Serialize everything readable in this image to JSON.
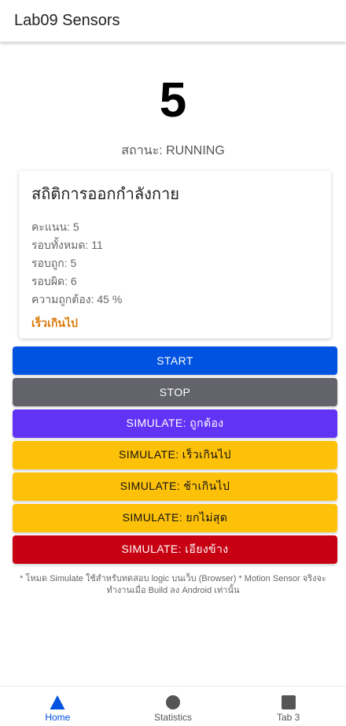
{
  "app": {
    "title": "Lab09 Sensors"
  },
  "score": {
    "value": "5"
  },
  "status": {
    "text": "สถานะ: RUNNING"
  },
  "stats": {
    "title": "สถิติการออกกำลังกาย",
    "score": "คะแนน: 5",
    "total": "รอบทั้งหมด: 11",
    "correct": "รอบถูก: 5",
    "wrong": "รอบผิด: 6",
    "accuracy": "ความถูกต้อง: 45 %",
    "feedback": "เร็วเกินไป",
    "feedback_color": "#d97706"
  },
  "buttons": {
    "start": {
      "label": "START",
      "bg": "#0052e0",
      "fg": "#ffffff"
    },
    "stop": {
      "label": "STOP",
      "bg": "#63646b",
      "fg": "#ffffff"
    },
    "sim_correct": {
      "label": "SIMULATE: ถูกต้อง",
      "bg": "#6133f5",
      "fg": "#ffffff"
    },
    "sim_fast": {
      "label": "SIMULATE: เร็วเกินไป",
      "bg": "#fdc10a",
      "fg": "#111111"
    },
    "sim_slow": {
      "label": "SIMULATE: ช้าเกินไป",
      "bg": "#fdc10a",
      "fg": "#111111"
    },
    "sim_nofull": {
      "label": "SIMULATE: ยกไม่สุด",
      "bg": "#fdc10a",
      "fg": "#111111"
    },
    "sim_tilt": {
      "label": "SIMULATE: เอียงข้าง",
      "bg": "#c70012",
      "fg": "#ffffff"
    }
  },
  "note": {
    "text": "* โหมด Simulate ใช้สำหรับทดสอบ logic บนเว็บ (Browser) * Motion Sensor จริงจะทำงานเมื่อ Build ลง Android เท่านั้น"
  },
  "tabs": [
    {
      "label": "Home",
      "icon": "triangle-icon",
      "active": true
    },
    {
      "label": "Statistics",
      "icon": "circle-icon",
      "active": false
    },
    {
      "label": "Tab 3",
      "icon": "square-icon",
      "active": false
    }
  ],
  "colors": {
    "tab_active": "#0052e0",
    "tab_inactive": "#555555",
    "tab_icon_inactive": "#555555"
  }
}
